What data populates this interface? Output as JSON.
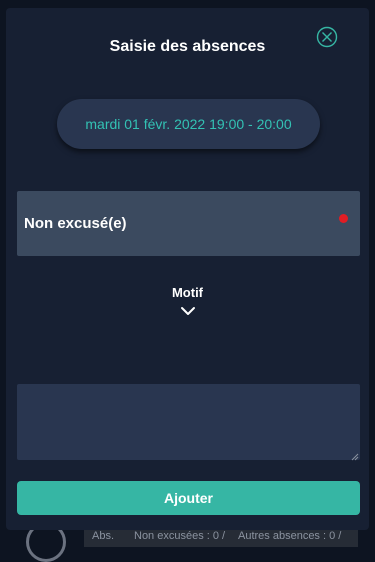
{
  "background": {
    "abs_label": "Abs.",
    "non_excused": "Non excusées : 0 /",
    "other_absences": "Autres absences : 0 /"
  },
  "modal": {
    "title": "Saisie des absences",
    "close_icon": "close-circle-icon",
    "date_range": "mardi 01 févr. 2022 19:00 - 20:00",
    "status": {
      "label": "Non excusé(e)",
      "indicator_color": "#e11d24"
    },
    "motif": {
      "label": "Motif",
      "icon": "chevron-down-icon"
    },
    "comment_value": "",
    "add_button": "Ajouter"
  },
  "colors": {
    "modal_bg": "#172033",
    "accent": "#36b6a4",
    "date_text": "#33c2b4",
    "status_bg": "#3b4a5f"
  }
}
